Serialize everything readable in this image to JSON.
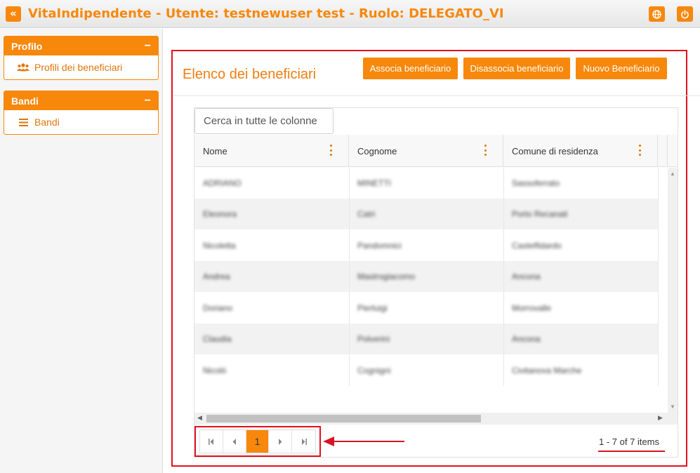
{
  "header": {
    "title": "VitaIndipendente - Utente: testnewuser test - Ruolo: DELEGATO_VI",
    "collapse_icon": "double-chevron-left-icon",
    "globe_icon": "globe-icon",
    "power_icon": "power-icon"
  },
  "sidebar": {
    "panels": [
      {
        "title": "Profilo",
        "items": [
          {
            "label": "Profili dei beneficiari",
            "icon": "users-icon"
          }
        ]
      },
      {
        "title": "Bandi",
        "items": [
          {
            "label": "Bandi",
            "icon": "list-icon"
          }
        ]
      }
    ]
  },
  "main": {
    "title": "Elenco dei beneficiari",
    "buttons": {
      "associa": "Associa beneficiario",
      "disassocia": "Disassocia beneficiario",
      "nuovo": "Nuovo Beneficiario"
    },
    "grid": {
      "search_placeholder": "Cerca in tutte le colonne",
      "columns": [
        "Nome",
        "Cognome",
        "Comune di residenza"
      ],
      "rows": [
        [
          "ADRIANO",
          "MINETTI",
          "Sassoferrato"
        ],
        [
          "Eleonora",
          "Catri",
          "Porto Recanati"
        ],
        [
          "Nicoletta",
          "Pandomnici",
          "Castelfidardo"
        ],
        [
          "Andrea",
          "Mastrogiacomo",
          "Ancona"
        ],
        [
          "Doriano",
          "Pierluigi",
          "Morrovalle"
        ],
        [
          "Claudia",
          "Polverini",
          "Ancona"
        ],
        [
          "Nicolò",
          "Cognigni",
          "Civitanova Marche"
        ]
      ]
    },
    "pager": {
      "current_page": "1",
      "summary": "1 - 7 of 7 items"
    }
  },
  "colors": {
    "accent": "#f7880c",
    "highlight_red": "#e30f1d"
  }
}
